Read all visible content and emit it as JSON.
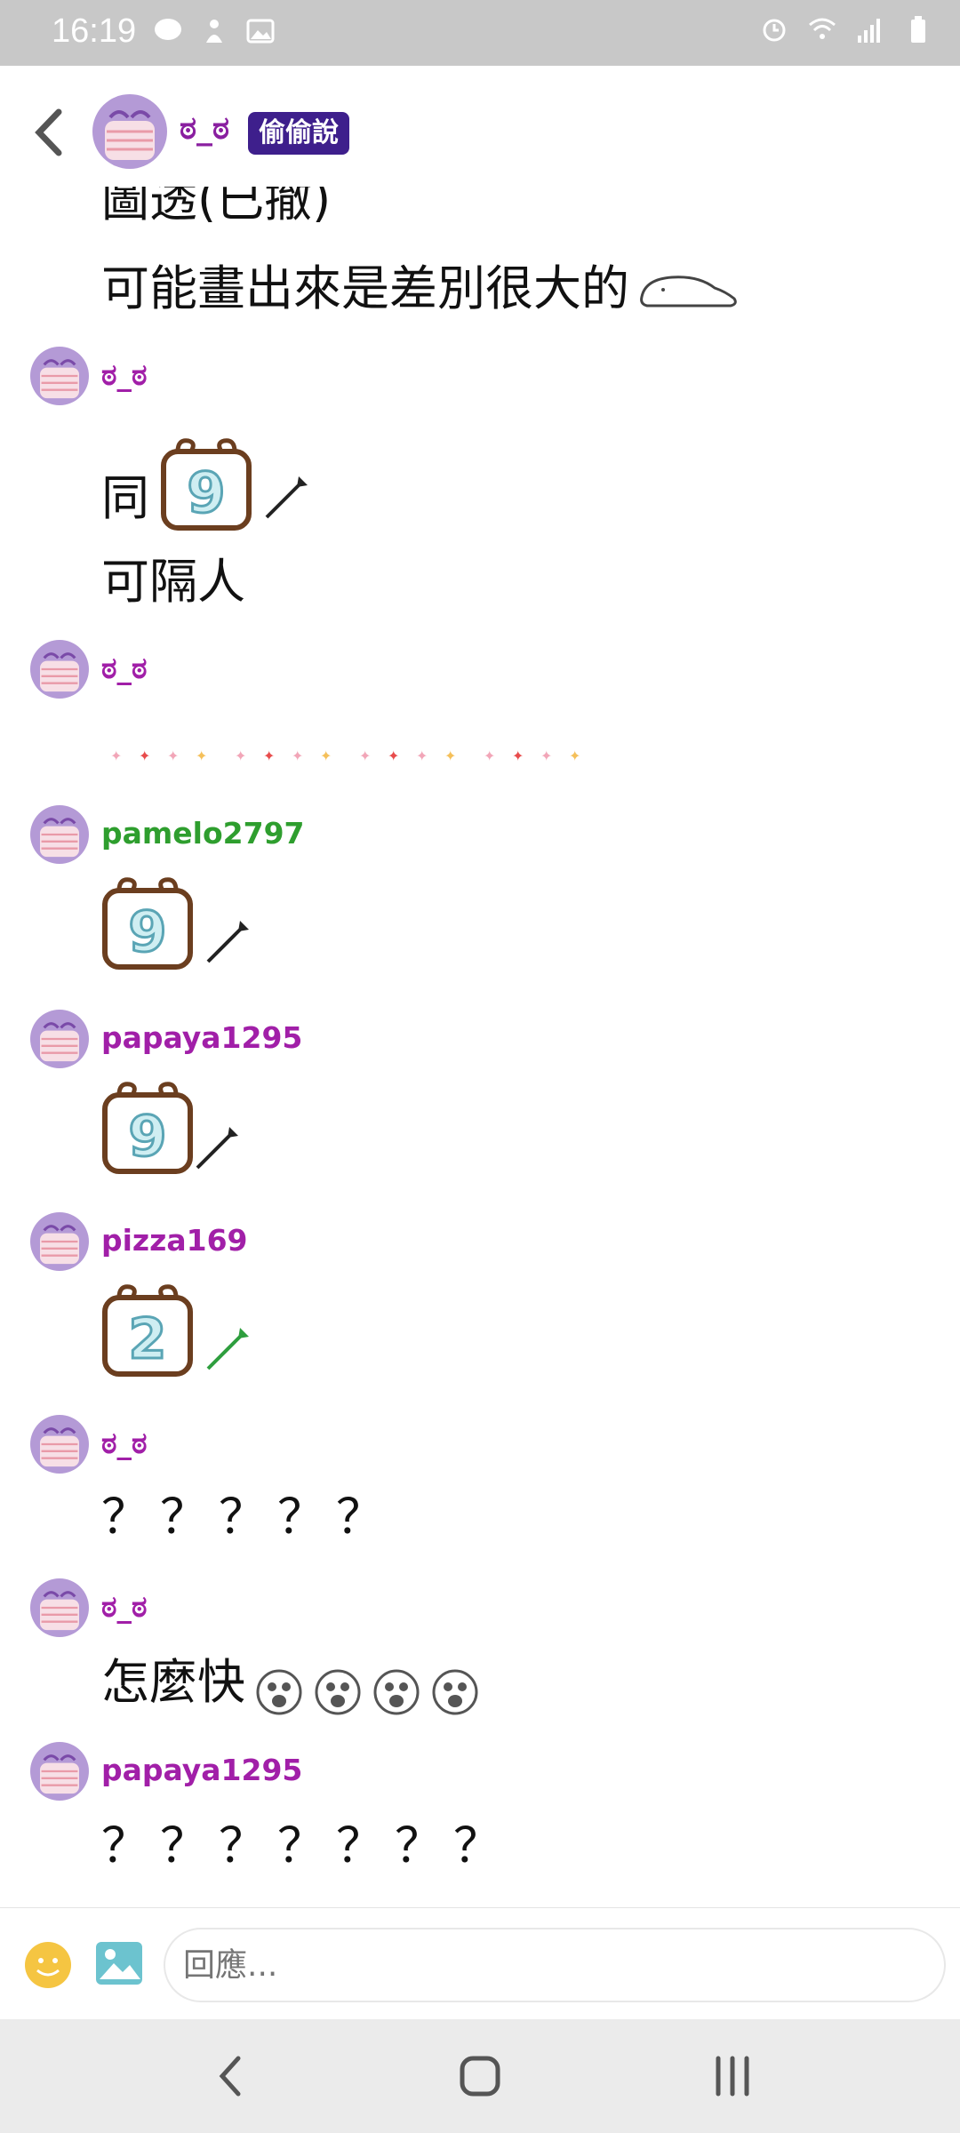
{
  "status_bar": {
    "time": "16:19",
    "left_icons": [
      "line-icon",
      "notification-icon",
      "gallery-icon"
    ],
    "right_icons": [
      "alarm-icon",
      "wifi-icon",
      "signal-icon",
      "battery-icon"
    ]
  },
  "header": {
    "name": "ಠ_ಠ",
    "badge": "偷偷說"
  },
  "chat": {
    "partial_top_text": "圖透(已撤)",
    "partial_text": "可能畫出來是差別很大的",
    "messages": [
      {
        "username": "ಠ_ಠ",
        "line1": "同",
        "line2": "可隔人",
        "sticker_number": "9"
      },
      {
        "username": "ಠ_ಠ"
      },
      {
        "username": "pamelo2797",
        "sticker_number": "9"
      },
      {
        "username": "papaya1295",
        "sticker_number": "9"
      },
      {
        "username": "pizza169",
        "sticker_number": "2"
      },
      {
        "username": "ಠ_ಠ",
        "text": "？？？？？"
      },
      {
        "username": "ಠ_ಠ",
        "text": "怎麼快"
      },
      {
        "username": "papaya1295",
        "text": "？？？？？？？"
      }
    ]
  },
  "input": {
    "placeholder": "回應..."
  },
  "colors": {
    "username_purple": "#a11fa8",
    "username_green": "#2e9e2e",
    "badge_bg": "#3e1f8c",
    "statusbar_bg": "#c8c8c8"
  }
}
